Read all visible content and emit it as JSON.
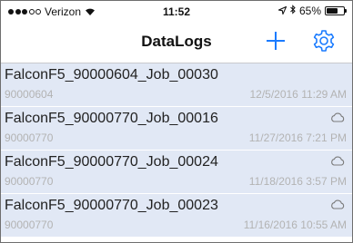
{
  "status_bar": {
    "carrier": "Verizon",
    "time": "11:52",
    "battery": "65%",
    "battery_level": 0.65,
    "signal_bars": 3,
    "signal_total": 5,
    "icons": [
      "wifi-icon",
      "location-arrow-icon",
      "bluetooth-icon",
      "battery-icon"
    ]
  },
  "nav": {
    "title": "DataLogs",
    "add_icon": "plus-icon",
    "settings_icon": "gear-icon",
    "accent_color": "#1a7bff"
  },
  "list": {
    "row_background": "#e1e8f5",
    "items": [
      {
        "title": "FalconF5_90000604_Job_00030",
        "device": "90000604",
        "date": "12/5/2016 11:29 AM",
        "cloud": false
      },
      {
        "title": "FalconF5_90000770_Job_00016",
        "device": "90000770",
        "date": "11/27/2016 7:21 PM",
        "cloud": true
      },
      {
        "title": "FalconF5_90000770_Job_00024",
        "device": "90000770",
        "date": "11/18/2016 3:57 PM",
        "cloud": true
      },
      {
        "title": "FalconF5_90000770_Job_00023",
        "device": "90000770",
        "date": "11/16/2016 10:55 AM",
        "cloud": true
      }
    ]
  }
}
